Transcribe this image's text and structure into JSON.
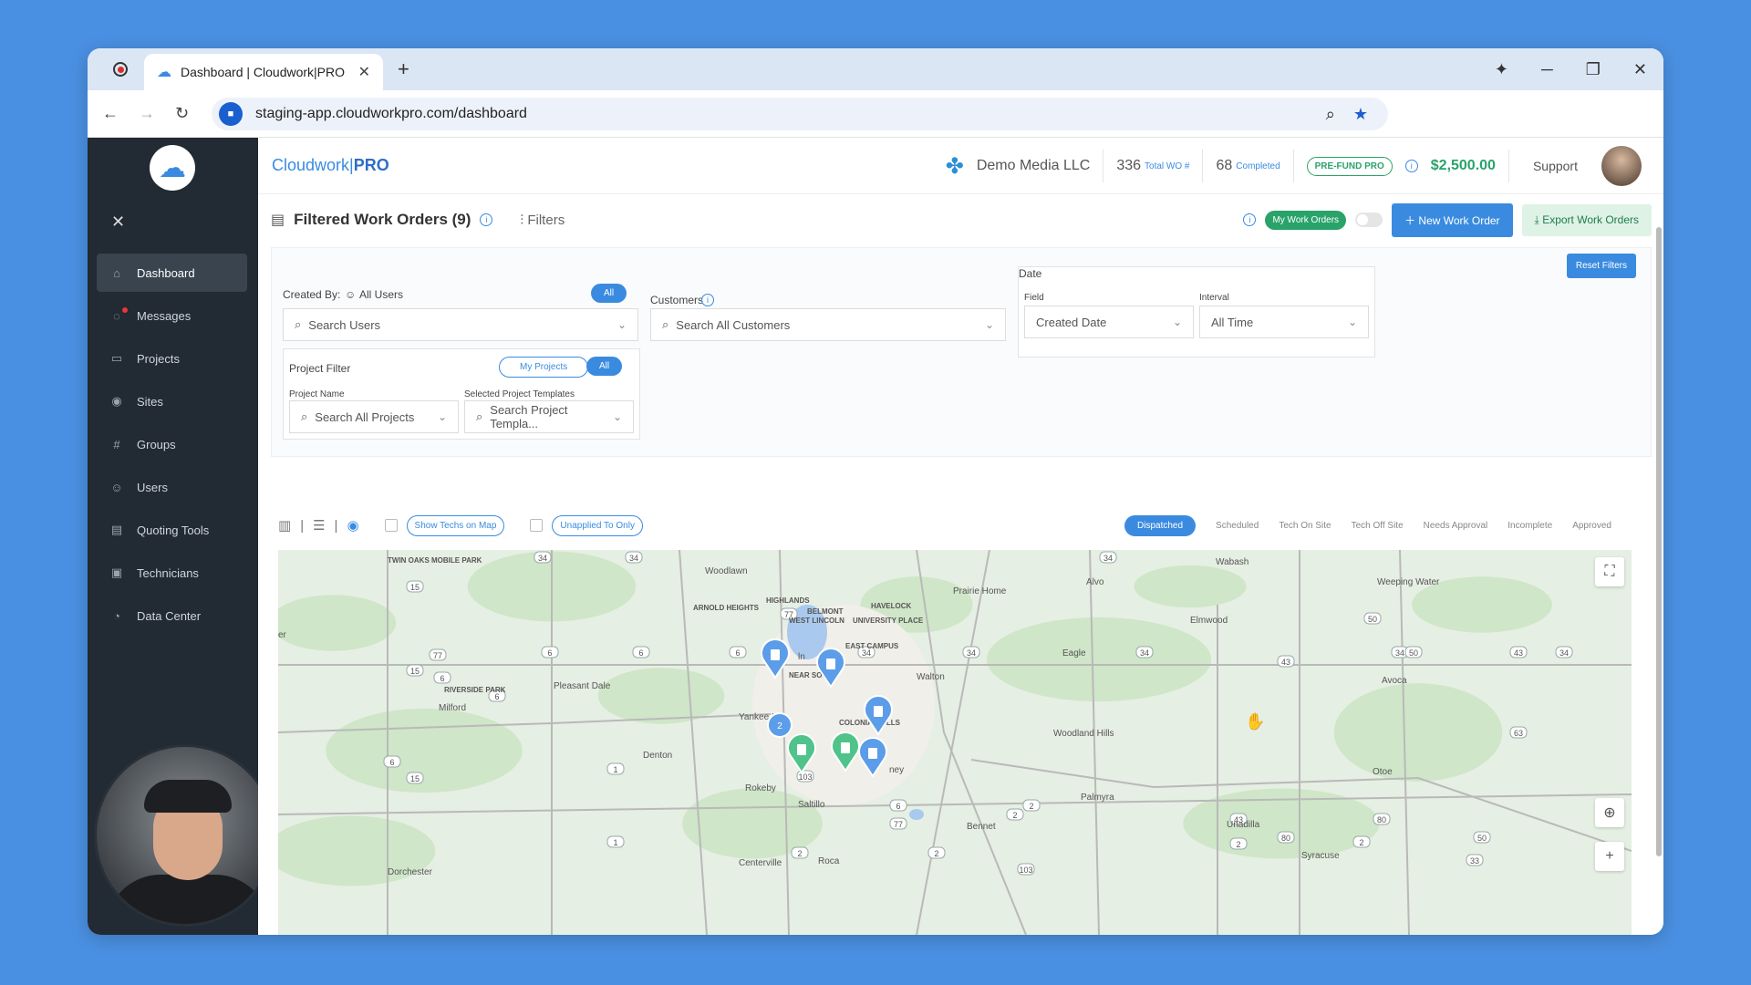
{
  "browser": {
    "tab_title": "Dashboard | Cloudwork|PRO",
    "url": "staging-app.cloudworkpro.com/dashboard"
  },
  "sidebar": {
    "items": [
      {
        "label": "Dashboard",
        "icon": "home-icon",
        "glyph": "⌂"
      },
      {
        "label": "Messages",
        "icon": "messages-icon",
        "glyph": "◌"
      },
      {
        "label": "Projects",
        "icon": "folder-icon",
        "glyph": "▭"
      },
      {
        "label": "Sites",
        "icon": "location-icon",
        "glyph": "◉"
      },
      {
        "label": "Groups",
        "icon": "hash-icon",
        "glyph": "#"
      },
      {
        "label": "Users",
        "icon": "users-icon",
        "glyph": "☺"
      },
      {
        "label": "Quoting Tools",
        "icon": "quote-icon",
        "glyph": "▤"
      },
      {
        "label": "Technicians",
        "icon": "technicians-icon",
        "glyph": "▣"
      },
      {
        "label": "Data Center",
        "icon": "data-center-icon",
        "glyph": "◔"
      }
    ]
  },
  "header": {
    "brand_main": "Cloudwork",
    "brand_sep": "|",
    "brand_pro": "PRO",
    "company": "Demo Media LLC",
    "total_wo_value": "336",
    "total_wo_label": "Total WO #",
    "completed_value": "68",
    "completed_label": "Completed",
    "prefund_label": "PRE-FUND PRO",
    "balance": "$2,500.00",
    "support": "Support"
  },
  "workorders": {
    "title": "Filtered Work Orders (9)",
    "filters_label": "Filters",
    "my_work_orders": "My Work Orders",
    "new_work_order": "New Work Order",
    "export_work_orders": "Export Work Orders",
    "reset_filters": "Reset Filters"
  },
  "filter_panel": {
    "created_by_label": "Created By:",
    "all_users": "All Users",
    "all_pill": "All",
    "search_users_placeholder": "Search Users",
    "customers_label": "Customers",
    "search_customers_placeholder": "Search All Customers",
    "date_label": "Date",
    "field_label": "Field",
    "field_value": "Created Date",
    "interval_label": "Interval",
    "interval_value": "All Time",
    "project_filter_label": "Project Filter",
    "my_projects": "My Projects",
    "project_all": "All",
    "project_name_label": "Project Name",
    "project_name_placeholder": "Search All Projects",
    "templates_label": "Selected Project Templates",
    "templates_placeholder": "Search Project Templa..."
  },
  "toolbar": {
    "show_techs": "Show Techs on Map",
    "unapplied_only": "Unapplied To Only",
    "statuses": [
      "Dispatched",
      "Scheduled",
      "Tech On Site",
      "Tech Off Site",
      "Needs Approval",
      "Incomplete",
      "Approved"
    ]
  },
  "map": {
    "places": [
      {
        "name": "TWIN OAKS MOBILE PARK",
        "size": "small"
      },
      {
        "name": "Woodlawn",
        "size": "normal"
      },
      {
        "name": "HIGHLANDS",
        "size": "small"
      },
      {
        "name": "ARNOLD HEIGHTS",
        "size": "small"
      },
      {
        "name": "BELMONT",
        "size": "small"
      },
      {
        "name": "HAVELOCK",
        "size": "small"
      },
      {
        "name": "WEST LINCOLN",
        "size": "small"
      },
      {
        "name": "UNIVERSITY PLACE",
        "size": "small"
      },
      {
        "name": "EAST CAMPUS",
        "size": "small"
      },
      {
        "name": "Prairie Home",
        "size": "normal"
      },
      {
        "name": "Alvo",
        "size": "normal"
      },
      {
        "name": "Wabash",
        "size": "normal"
      },
      {
        "name": "Weeping Water",
        "size": "normal"
      },
      {
        "name": "Elmwood",
        "size": "normal"
      },
      {
        "name": "Eagle",
        "size": "normal"
      },
      {
        "name": "Avoca",
        "size": "normal"
      },
      {
        "name": "RIVERSIDE PARK",
        "size": "small"
      },
      {
        "name": "Pleasant Dale",
        "size": "normal"
      },
      {
        "name": "Milford",
        "size": "normal"
      },
      {
        "name": "Walton",
        "size": "normal"
      },
      {
        "name": "NEAR SOUTH",
        "size": "small"
      },
      {
        "name": "Yankee Hill",
        "size": "normal"
      },
      {
        "name": "COLONIAL HILLS",
        "size": "small"
      },
      {
        "name": "Woodland Hills",
        "size": "normal"
      },
      {
        "name": "Denton",
        "size": "normal"
      },
      {
        "name": "Otoe",
        "size": "normal"
      },
      {
        "name": "Rokeby",
        "size": "normal"
      },
      {
        "name": "Saltillo",
        "size": "normal"
      },
      {
        "name": "Palmyra",
        "size": "normal"
      },
      {
        "name": "Bennet",
        "size": "normal"
      },
      {
        "name": "Unadilla",
        "size": "normal"
      },
      {
        "name": "Syracuse",
        "size": "normal"
      },
      {
        "name": "Centerville",
        "size": "normal"
      },
      {
        "name": "Roca",
        "size": "normal"
      },
      {
        "name": "Dorchester",
        "size": "normal"
      },
      {
        "name": "ln",
        "size": "normal"
      },
      {
        "name": "ney",
        "size": "normal"
      },
      {
        "name": "er",
        "size": "normal"
      }
    ],
    "route_shields": [
      "34",
      "34",
      "34",
      "34",
      "34",
      "34",
      "34",
      "34",
      "15",
      "15",
      "15",
      "6",
      "6",
      "6",
      "6",
      "6",
      "6",
      "6",
      "77",
      "77",
      "77",
      "80",
      "80",
      "2",
      "2",
      "2",
      "2",
      "2",
      "43",
      "43",
      "43",
      "63",
      "50",
      "50",
      "50",
      "1",
      "1",
      "103",
      "103",
      "33",
      "33",
      "2"
    ],
    "markers": [
      {
        "type": "work-order",
        "color": "#5b9de8"
      },
      {
        "type": "work-order",
        "color": "#5b9de8"
      },
      {
        "type": "work-order",
        "color": "#5b9de8"
      },
      {
        "type": "cluster",
        "color": "#5b9de8",
        "count": "2"
      },
      {
        "type": "work-order",
        "color": "#4fc38a"
      },
      {
        "type": "work-order",
        "color": "#4fc38a"
      },
      {
        "type": "work-order",
        "color": "#5b9de8"
      }
    ]
  }
}
